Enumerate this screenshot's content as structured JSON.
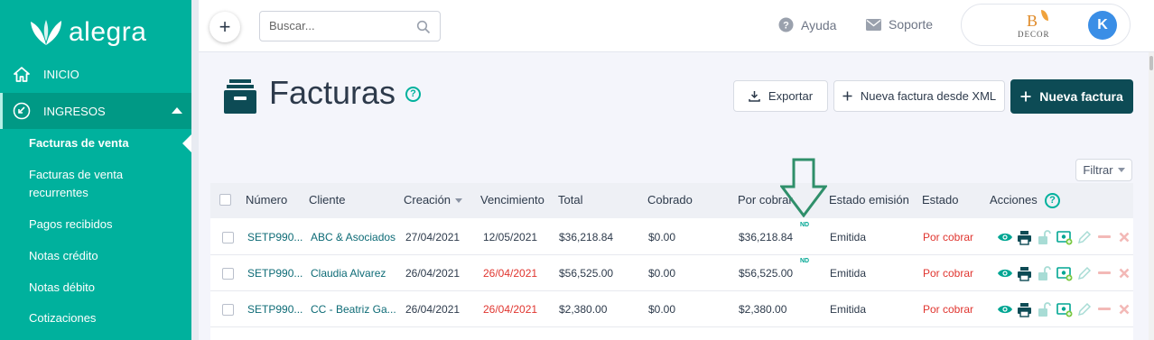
{
  "brand": {
    "name": "alegra"
  },
  "sidebar": {
    "inicio": "INICIO",
    "ingresos": "INGRESOS",
    "items": [
      {
        "label": "Facturas de venta"
      },
      {
        "label": "Facturas de venta"
      },
      {
        "label": "recurrentes"
      },
      {
        "label": "Pagos recibidos"
      },
      {
        "label": "Notas crédito"
      },
      {
        "label": "Notas débito"
      },
      {
        "label": "Cotizaciones"
      }
    ]
  },
  "topbar": {
    "add_label": "+",
    "search_placeholder": "Buscar...",
    "help": "Ayuda",
    "support": "Soporte",
    "company_logo_b": "B",
    "company_logo_text": "DECOR",
    "avatar_initial": "K"
  },
  "page": {
    "title": "Facturas",
    "help_glyph": "?",
    "export": "Exportar",
    "xml": "Nueva factura desde XML",
    "new": "Nueva factura",
    "filter": "Filtrar"
  },
  "table": {
    "headers": {
      "numero": "Número",
      "cliente": "Cliente",
      "creacion": "Creación",
      "vencimiento": "Vencimiento",
      "total": "Total",
      "cobrado": "Cobrado",
      "por_cobrar": "Por cobrar",
      "estado_emision": "Estado emisión",
      "estado": "Estado",
      "acciones": "Acciones"
    },
    "rows": [
      {
        "numero": "SETP990...",
        "cliente": "ABC & Asociados",
        "creacion": "27/04/2021",
        "vencimiento": "12/05/2021",
        "total": "$36,218.84",
        "cobrado": "$0.00",
        "por_cobrar": "$36,218.84",
        "nd": "ND",
        "estado_emision": "Emitida",
        "estado": "Por cobrar"
      },
      {
        "numero": "SETP990...",
        "cliente": "Claudia Alvarez",
        "creacion": "26/04/2021",
        "vencimiento": "26/04/2021",
        "total": "$56,525.00",
        "cobrado": "$0.00",
        "por_cobrar": "$56,525.00",
        "nd": "ND",
        "estado_emision": "Emitida",
        "estado": "Por cobrar"
      },
      {
        "numero": "SETP990...",
        "cliente": "CC - Beatriz Ga...",
        "creacion": "26/04/2021",
        "vencimiento": "26/04/2021",
        "total": "$2,380.00",
        "cobrado": "$0.00",
        "por_cobrar": "$2,380.00",
        "estado_emision": "Emitida",
        "estado": "Por cobrar"
      }
    ]
  },
  "colors": {
    "brand_teal": "#00b19d",
    "dark_teal": "#0d4b55",
    "danger_red": "#e0352f",
    "arrow_green": "#2f8f6a"
  },
  "icons": {
    "home": "home-icon",
    "ingresos": "income-icon",
    "search": "search-icon",
    "help": "question-circle-icon",
    "support": "envelope-icon",
    "export": "download-icon",
    "add": "plus-icon",
    "view": "eye-icon",
    "print": "printer-icon",
    "unlock": "unlock-icon",
    "payment": "add-payment-icon",
    "edit": "pencil-icon",
    "void": "minus-icon",
    "delete": "close-icon",
    "arrow": "arrow-down-icon"
  }
}
